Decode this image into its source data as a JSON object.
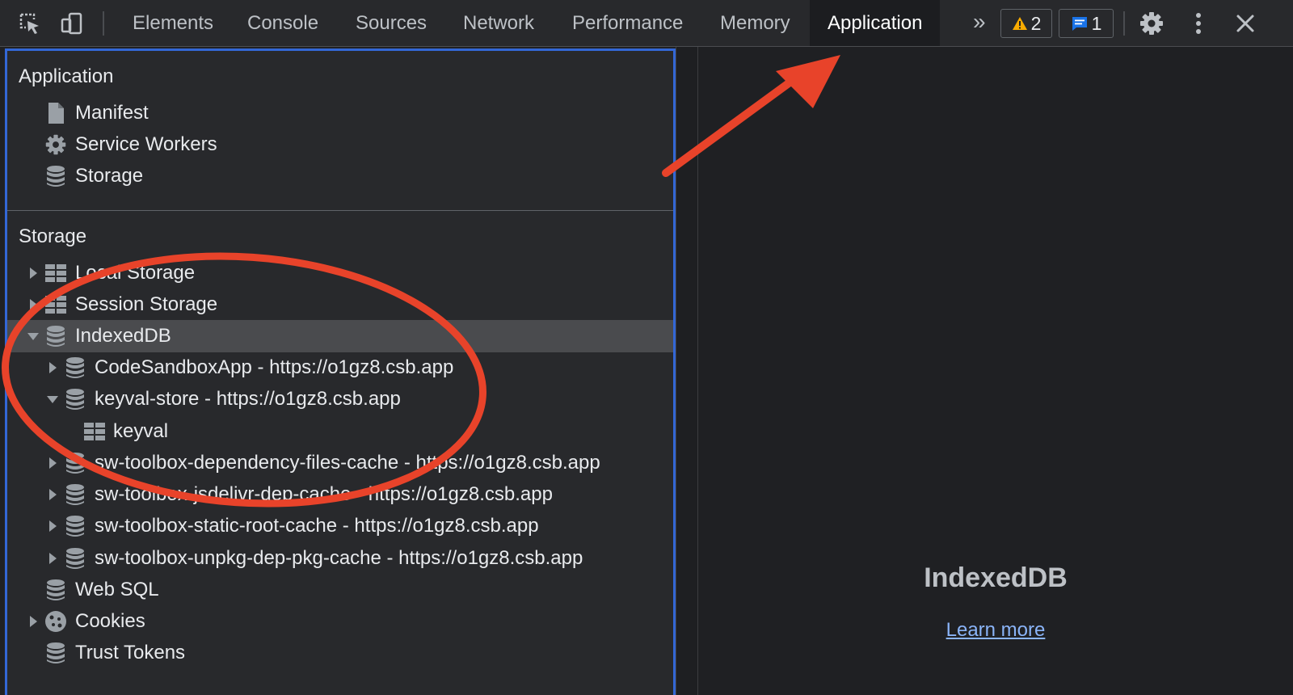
{
  "toolbar": {
    "tabs": [
      "Elements",
      "Console",
      "Sources",
      "Network",
      "Performance",
      "Memory",
      "Application"
    ],
    "active_tab": "Application",
    "more_tabs": "»",
    "warnings_count": "2",
    "messages_count": "1"
  },
  "sidebar": {
    "application_section": {
      "title": "Application",
      "items": [
        {
          "label": "Manifest",
          "icon": "file-icon"
        },
        {
          "label": "Service Workers",
          "icon": "gear-icon"
        },
        {
          "label": "Storage",
          "icon": "database-icon"
        }
      ]
    },
    "storage_section": {
      "title": "Storage",
      "items": [
        {
          "label": "Local Storage",
          "icon": "table-icon",
          "expander": "collapsed"
        },
        {
          "label": "Session Storage",
          "icon": "table-icon",
          "expander": "collapsed"
        },
        {
          "label": "IndexedDB",
          "icon": "database-icon",
          "expander": "expanded",
          "selected": true
        },
        {
          "label": "CodeSandboxApp - https://o1gz8.csb.app",
          "icon": "database-icon",
          "expander": "collapsed"
        },
        {
          "label": "keyval-store - https://o1gz8.csb.app",
          "icon": "database-icon",
          "expander": "expanded"
        },
        {
          "label": "keyval",
          "icon": "table-icon"
        },
        {
          "label": "sw-toolbox-dependency-files-cache - https://o1gz8.csb.app",
          "icon": "database-icon",
          "expander": "collapsed"
        },
        {
          "label": "sw-toolbox-jsdelivr-dep-cache - https://o1gz8.csb.app",
          "icon": "database-icon",
          "expander": "collapsed"
        },
        {
          "label": "sw-toolbox-static-root-cache - https://o1gz8.csb.app",
          "icon": "database-icon",
          "expander": "collapsed"
        },
        {
          "label": "sw-toolbox-unpkg-dep-pkg-cache - https://o1gz8.csb.app",
          "icon": "database-icon",
          "expander": "collapsed"
        },
        {
          "label": "Web SQL",
          "icon": "database-icon"
        },
        {
          "label": "Cookies",
          "icon": "cookie-icon",
          "expander": "collapsed"
        },
        {
          "label": "Trust Tokens",
          "icon": "database-icon"
        }
      ]
    }
  },
  "main": {
    "title": "IndexedDB",
    "link": "Learn more"
  },
  "colors": {
    "toolbar_bg": "#28292c",
    "sidebar_bg": "#28292c",
    "focus_border": "#3367d6",
    "selected_row": "#4a4b4e",
    "link": "#8ab4f8",
    "annotation": "#e8432a",
    "warning": "#f9ab00",
    "message": "#1a73e8"
  }
}
